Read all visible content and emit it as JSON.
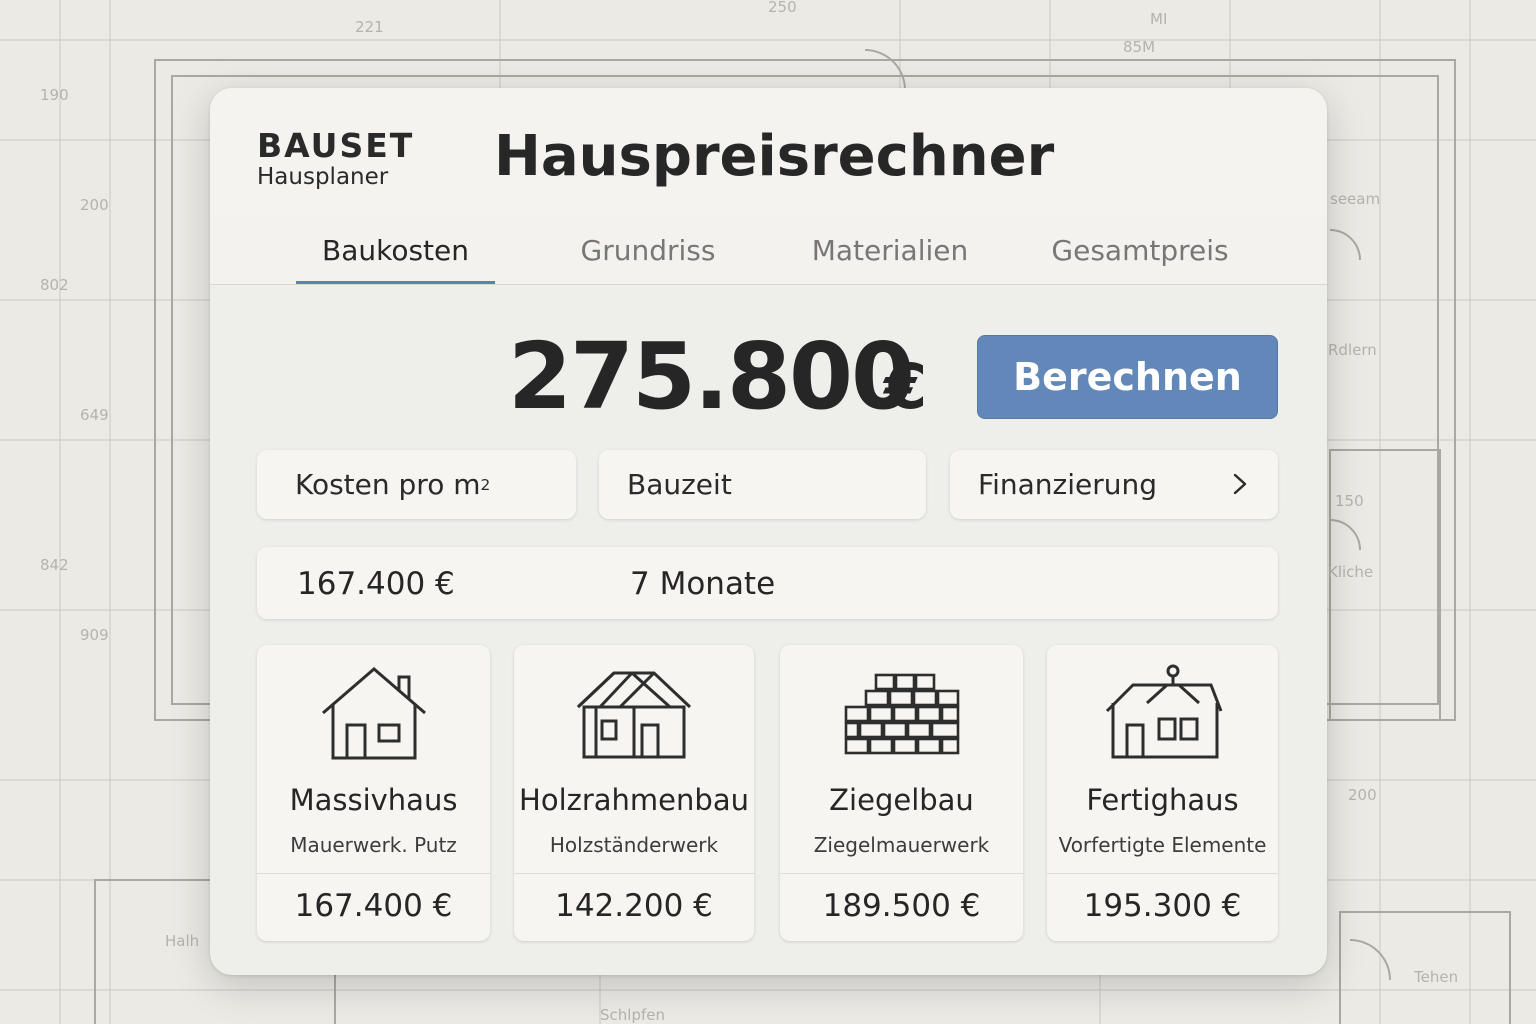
{
  "brand": {
    "name": "BAUSET",
    "sub": "Hausplaner"
  },
  "title": "Hauspreisrechner",
  "tabs": [
    {
      "label": "Baukosten",
      "active": true
    },
    {
      "label": "Grundriss",
      "active": false
    },
    {
      "label": "Materialien",
      "active": false
    },
    {
      "label": "Gesamtpreis",
      "active": false
    }
  ],
  "total": {
    "amount": "275.800",
    "currency": "€"
  },
  "calculate_label": "Berechnen",
  "metrics": {
    "cost_per_sqm_label": "Kosten pro m",
    "cost_per_sqm_sup": "2",
    "duration_label": "Bauzeit",
    "financing_label": "Finanzierung",
    "cost_value": "167.400 €",
    "duration_value": "7 Monate"
  },
  "house_types": [
    {
      "name": "Massivhaus",
      "desc": "Mauerwerk. Putz",
      "price": "167.400 €",
      "icon": "house-icon"
    },
    {
      "name": "Holzrahmenbau",
      "desc": "Holzständerwerk",
      "price": "142.200 €",
      "icon": "timber-frame-icon"
    },
    {
      "name": "Ziegelbau",
      "desc": "Ziegelmauerwerk",
      "price": "189.500 €",
      "icon": "brick-wall-icon"
    },
    {
      "name": "Fertighaus",
      "desc": "Vorfertigte Elemente",
      "price": "195.300 €",
      "icon": "prefab-house-icon"
    }
  ],
  "blueprint_labels": [
    "221",
    "250",
    "85M",
    "MI",
    "seeam",
    "Rdlern",
    "150",
    "Kliche",
    "200",
    "Halh",
    "Schlpfen",
    "Tehen"
  ],
  "colors": {
    "accent": "#6188b8",
    "text": "#262626",
    "card": "#eeeeeb"
  }
}
